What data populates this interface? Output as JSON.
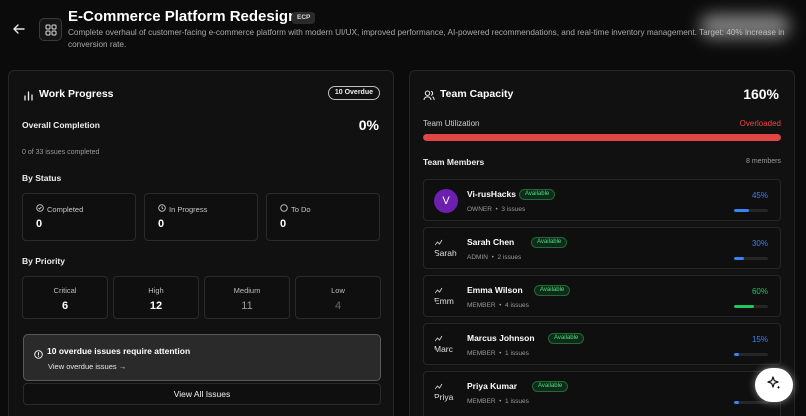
{
  "header": {
    "title": "E-Commerce Platform Redesign",
    "key": "ECP",
    "description": "Complete overhaul of customer-facing e-commerce platform with modern UI/UX, improved performance, AI-powered recommendations, and real-time inventory management. Target: 40% increase in conversion rate."
  },
  "work_progress": {
    "title": "Work Progress",
    "overdue_badge": "10 Overdue",
    "overall_label": "Overall Completion",
    "overall_value": "0%",
    "issues_completed": "0 of 33 issues completed",
    "by_status_label": "By Status",
    "status": [
      {
        "label": "Completed",
        "value": "0",
        "icon": "check-circle-icon"
      },
      {
        "label": "In Progress",
        "value": "0",
        "icon": "clock-icon"
      },
      {
        "label": "To Do",
        "value": "0",
        "icon": "circle-icon"
      }
    ],
    "by_priority_label": "By Priority",
    "priority": [
      {
        "label": "Critical",
        "value": "6"
      },
      {
        "label": "High",
        "value": "12"
      },
      {
        "label": "Medium",
        "value": "11"
      },
      {
        "label": "Low",
        "value": "4"
      }
    ],
    "alert_title": "10 overdue issues require attention",
    "alert_link": "View overdue issues →",
    "view_all": "View All Issues"
  },
  "team_capacity": {
    "title": "Team Capacity",
    "percent": "160%",
    "utilization_label": "Team Utilization",
    "utilization_status": "Overloaded",
    "utilization_fill": 1.0,
    "members_label": "Team Members",
    "members_count": "8 members",
    "members": [
      {
        "name": "Vi-rusHacks",
        "status": "Available",
        "role": "OWNER",
        "issues": "3 issues",
        "percent": "45%",
        "avatar_text": "V",
        "fill": 0.45,
        "color": "#3b82f6"
      },
      {
        "name": "Sarah Chen",
        "status": "Available",
        "role": "ADMIN",
        "issues": "2 issues",
        "percent": "30%",
        "avatar_text": "Sarah",
        "fill": 0.3,
        "color": "#3b82f6"
      },
      {
        "name": "Emma Wilson",
        "status": "Available",
        "role": "MEMBER",
        "issues": "4 issues",
        "percent": "60%",
        "avatar_text": "Emm",
        "fill": 0.6,
        "color": "#22c55e"
      },
      {
        "name": "Marcus Johnson",
        "status": "Available",
        "role": "MEMBER",
        "issues": "1 issues",
        "percent": "15%",
        "avatar_text": "Marc",
        "fill": 0.15,
        "color": "#3b82f6"
      },
      {
        "name": "Priya Kumar",
        "status": "Available",
        "role": "MEMBER",
        "issues": "1 issues",
        "percent": "",
        "avatar_text": "Priya",
        "fill": 0.15,
        "color": "#3b82f6"
      }
    ]
  },
  "colors": {
    "overload": "#ef4444",
    "available": "#4ade80",
    "accent_blue": "#3b82f6"
  }
}
